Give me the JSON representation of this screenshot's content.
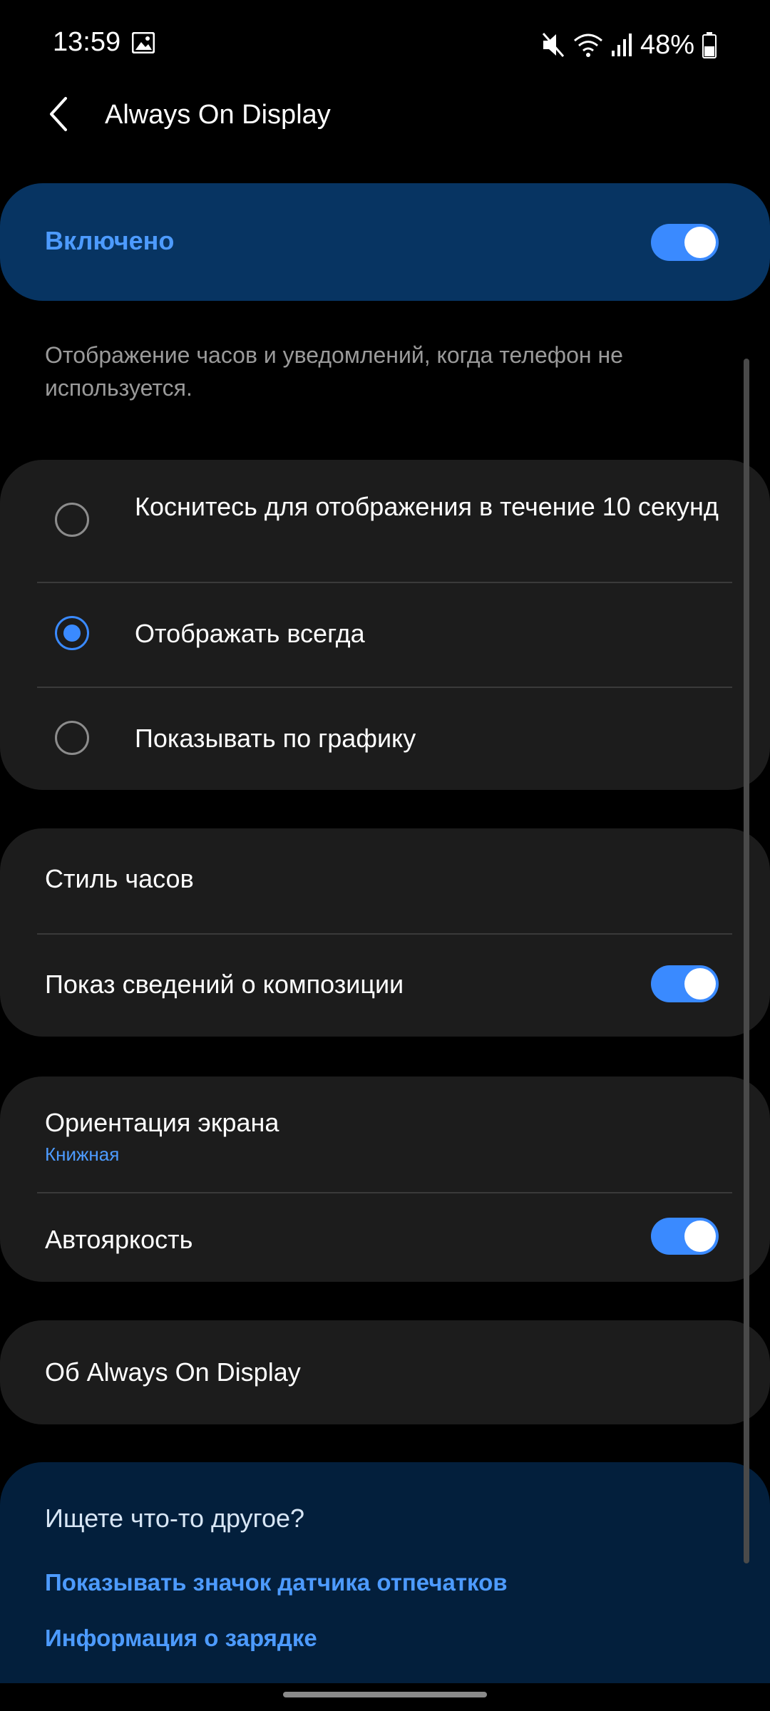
{
  "status_bar": {
    "time": "13:59",
    "battery": "48%",
    "icons": [
      "gallery-icon",
      "mute-icon",
      "wifi-icon",
      "signal-icon",
      "battery-icon"
    ]
  },
  "header": {
    "title": "Always On Display"
  },
  "master_toggle": {
    "label": "Включено",
    "on": true
  },
  "description": "Отображение часов и уведомлений, когда телефон не используется.",
  "display_mode": {
    "options": [
      {
        "label": "Коснитесь для отображения в течение 10 секунд",
        "selected": false
      },
      {
        "label": "Отображать всегда",
        "selected": true
      },
      {
        "label": "Показывать по графику",
        "selected": false
      }
    ]
  },
  "settings_group_1": {
    "clock_style": "Стиль часов",
    "show_music": {
      "label": "Показ сведений о композиции",
      "on": true
    }
  },
  "settings_group_2": {
    "orientation": {
      "label": "Ориентация экрана",
      "value": "Книжная"
    },
    "auto_brightness": {
      "label": "Автояркость",
      "on": true
    }
  },
  "about": "Об Always On Display",
  "suggestions": {
    "question": "Ищете что-то другое?",
    "links": [
      "Показывать значок датчика отпечатков",
      "Информация о зарядке"
    ]
  },
  "colors": {
    "accent": "#3a8aff",
    "card": "#1c1c1c",
    "master_bg": "#073462",
    "suggest_bg": "#031f3c"
  }
}
